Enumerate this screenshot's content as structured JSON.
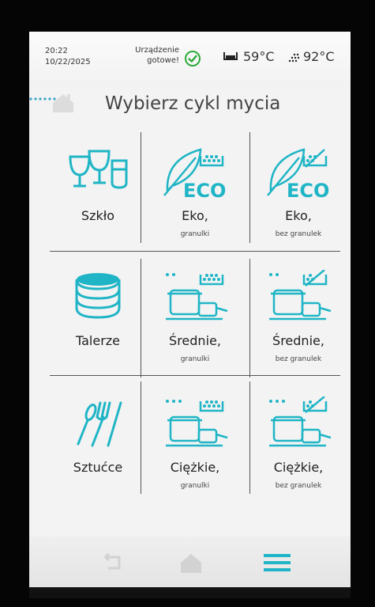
{
  "status": {
    "time": "20:22",
    "date": "10/22/2025",
    "device_ready": "Urządzenie gotowe!",
    "tank_temp": "59°C",
    "humidity": "92°C"
  },
  "header": {
    "title": "Wybierz cykl mycia"
  },
  "cycles": [
    {
      "label": "Szkło",
      "sub": ""
    },
    {
      "label": "Eko,",
      "sub": "granulki"
    },
    {
      "label": "Eko,",
      "sub": "bez granulek"
    },
    {
      "label": "Talerze",
      "sub": ""
    },
    {
      "label": "Średnie,",
      "sub": "granulki"
    },
    {
      "label": "Średnie,",
      "sub": "bez granulek"
    },
    {
      "label": "Sztućce",
      "sub": ""
    },
    {
      "label": "Ciężkie,",
      "sub": "granulki"
    },
    {
      "label": "Ciężkie,",
      "sub": "bez granulek"
    }
  ],
  "eco_text": "ECO",
  "icons": {
    "ready": "check-circle-icon",
    "tank": "tank-icon",
    "humidity": "steam-dots-icon",
    "home": "home-icon",
    "back": "back-arrow-icon",
    "menu": "hamburger-menu-icon"
  },
  "colors": {
    "accent": "#1fb5c6",
    "check": "#2eaa3a",
    "text": "#333333"
  }
}
